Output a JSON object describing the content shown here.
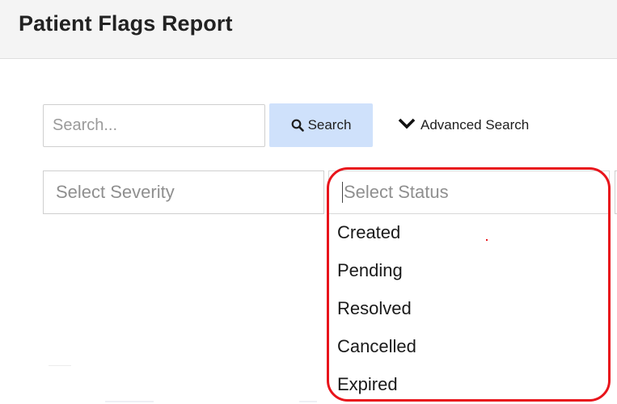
{
  "header": {
    "title": "Patient Flags Report"
  },
  "search": {
    "placeholder": "Search...",
    "button_label": "Search",
    "button_icon": "search-icon"
  },
  "advanced_search": {
    "label": "Advanced Search",
    "icon": "chevron-down-icon"
  },
  "filters": {
    "severity_placeholder": "Select Severity",
    "status_placeholder": "Select Status",
    "status_options": [
      "Created",
      "Pending",
      "Resolved",
      "Cancelled",
      "Expired"
    ]
  },
  "colors": {
    "accent_button": "#cfe1fb",
    "highlight": "#e8141b",
    "header_bg": "#f4f4f4"
  }
}
